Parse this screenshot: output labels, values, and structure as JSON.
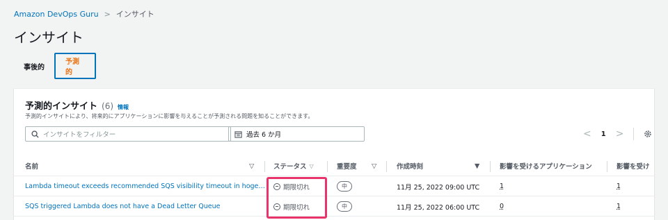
{
  "breadcrumb": {
    "root": "Amazon DevOps Guru",
    "separator": ">",
    "current": "インサイト"
  },
  "page": {
    "title": "インサイト"
  },
  "tabs": [
    {
      "label": "事後的",
      "active": false
    },
    {
      "label": "予測的",
      "active": true
    }
  ],
  "panel": {
    "title": "予測的インサイト",
    "count": "(6)",
    "info": "情報",
    "description": "予測的インサイトにより、将来的にアプリケーションに影響を与えることが予測される問題を知ることができます。"
  },
  "filter": {
    "placeholder": "インサイトをフィルター",
    "date_range": "過去 6 か月"
  },
  "pagination": {
    "prev": "<",
    "page": "1",
    "next": ">"
  },
  "table": {
    "headers": {
      "name": "名前",
      "status": "ステータス",
      "severity": "重要度",
      "created": "作成時刻",
      "apps": "影響を受けるアプリケーション",
      "affected": "影響を受け"
    },
    "rows": [
      {
        "name": "Lambda timeout exceeds recommended SQS visibility timeout in hoge…",
        "status": "期限切れ",
        "severity": "中",
        "created": "11月 25, 2022 09:00 UTC",
        "apps": "1",
        "affected": "1"
      },
      {
        "name": "SQS triggered Lambda does not have a Dead Letter Queue",
        "status": "期限切れ",
        "severity": "中",
        "created": "11月 25, 2022 06:00 UTC",
        "apps": "0",
        "affected": "1"
      }
    ]
  },
  "colors": {
    "link": "#0073bb",
    "accent_tab": "#ec7211",
    "highlight": "#e8336b"
  }
}
